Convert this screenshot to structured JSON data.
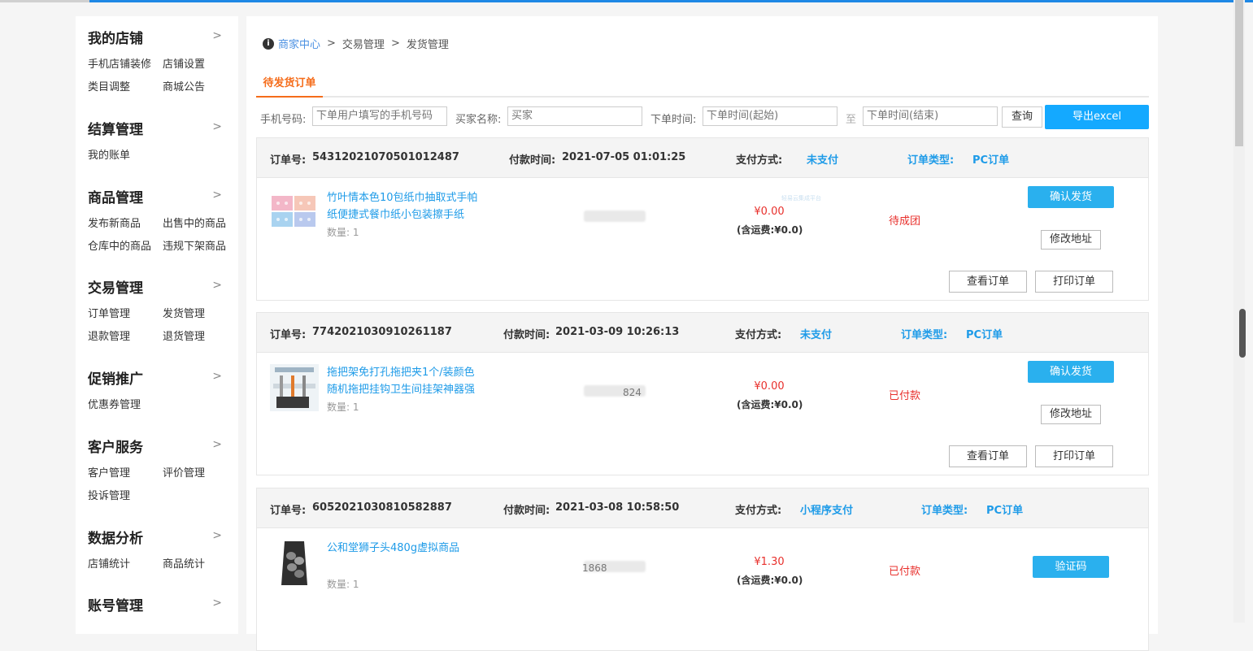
{
  "sidebar": {
    "sections": [
      {
        "title": "我的店铺",
        "links": [
          "手机店铺装修",
          "店铺设置",
          "类目调整",
          "商城公告"
        ]
      },
      {
        "title": "结算管理",
        "links": [
          "我的账单"
        ]
      },
      {
        "title": "商品管理",
        "links": [
          "发布新商品",
          "出售中的商品",
          "仓库中的商品",
          "违规下架商品"
        ]
      },
      {
        "title": "交易管理",
        "links": [
          "订单管理",
          "发货管理",
          "退款管理",
          "退货管理"
        ]
      },
      {
        "title": "促销推广",
        "links": [
          "优惠券管理"
        ]
      },
      {
        "title": "客户服务",
        "links": [
          "客户管理",
          "评价管理",
          "投诉管理"
        ]
      },
      {
        "title": "数据分析",
        "links": [
          "店铺统计",
          "商品统计"
        ]
      },
      {
        "title": "账号管理",
        "links": []
      }
    ],
    "chevron": ">"
  },
  "breadcrumb": {
    "home": "商家中心",
    "sep": ">",
    "level2": "交易管理",
    "level3": "发货管理",
    "icon": "info-icon"
  },
  "tab": {
    "label": "待发货订单"
  },
  "filters": {
    "phone_label": "手机号码:",
    "phone_placeholder": "下单用户填写的手机号码",
    "buyer_label": "买家名称:",
    "buyer_placeholder": "买家",
    "time_label": "下单时间:",
    "start_placeholder": "下单时间(起始)",
    "to_label": "至",
    "end_placeholder": "下单时间(结束)",
    "query_btn": "查询",
    "export_btn": "导出excel"
  },
  "labels": {
    "order_no": "订单号:",
    "pay_time": "付款时间:",
    "pay_method": "支付方式:",
    "order_type": "订单类型:",
    "qty": "数量:",
    "ship_btn": "确认发货",
    "addr_btn": "修改地址",
    "view_btn": "查看订单",
    "print_btn": "打印订单",
    "verify_btn": "验证码"
  },
  "orders": [
    {
      "no": "54312021070501012487",
      "time": "2021-07-05 01:01:25",
      "method": "未支付",
      "type": "PC订单",
      "product": "竹叶情本色10包纸巾抽取式手帕纸便捷式餐巾纸小包装擦手纸",
      "qty": "1",
      "phone": "",
      "price": "¥0.00",
      "freight": "(含运费:¥0.0)",
      "status": "待成团",
      "watermark": "轻易云集成平台"
    },
    {
      "no": "7742021030910261187",
      "time": "2021-03-09 10:26:13",
      "method": "未支付",
      "type": "PC订单",
      "product": "拖把架免打孔拖把夹1个/装颜色随机拖把挂钩卫生间挂架神器强",
      "qty": "1",
      "phone": "824",
      "price": "¥0.00",
      "freight": "(含运费:¥0.0)",
      "status": "已付款"
    },
    {
      "no": "6052021030810582887",
      "time": "2021-03-08 10:58:50",
      "method": "小程序支付",
      "type": "PC订单",
      "product": "公和堂狮子头480g虚拟商品",
      "qty": "1",
      "phone": "1868",
      "price": "¥1.30",
      "freight": "(含运费:¥0.0)",
      "status": "已付款"
    }
  ],
  "colors": {
    "accent": "#1e9be8",
    "orange": "#f56c1a",
    "red": "#e8302c",
    "export": "#14a9ff"
  }
}
